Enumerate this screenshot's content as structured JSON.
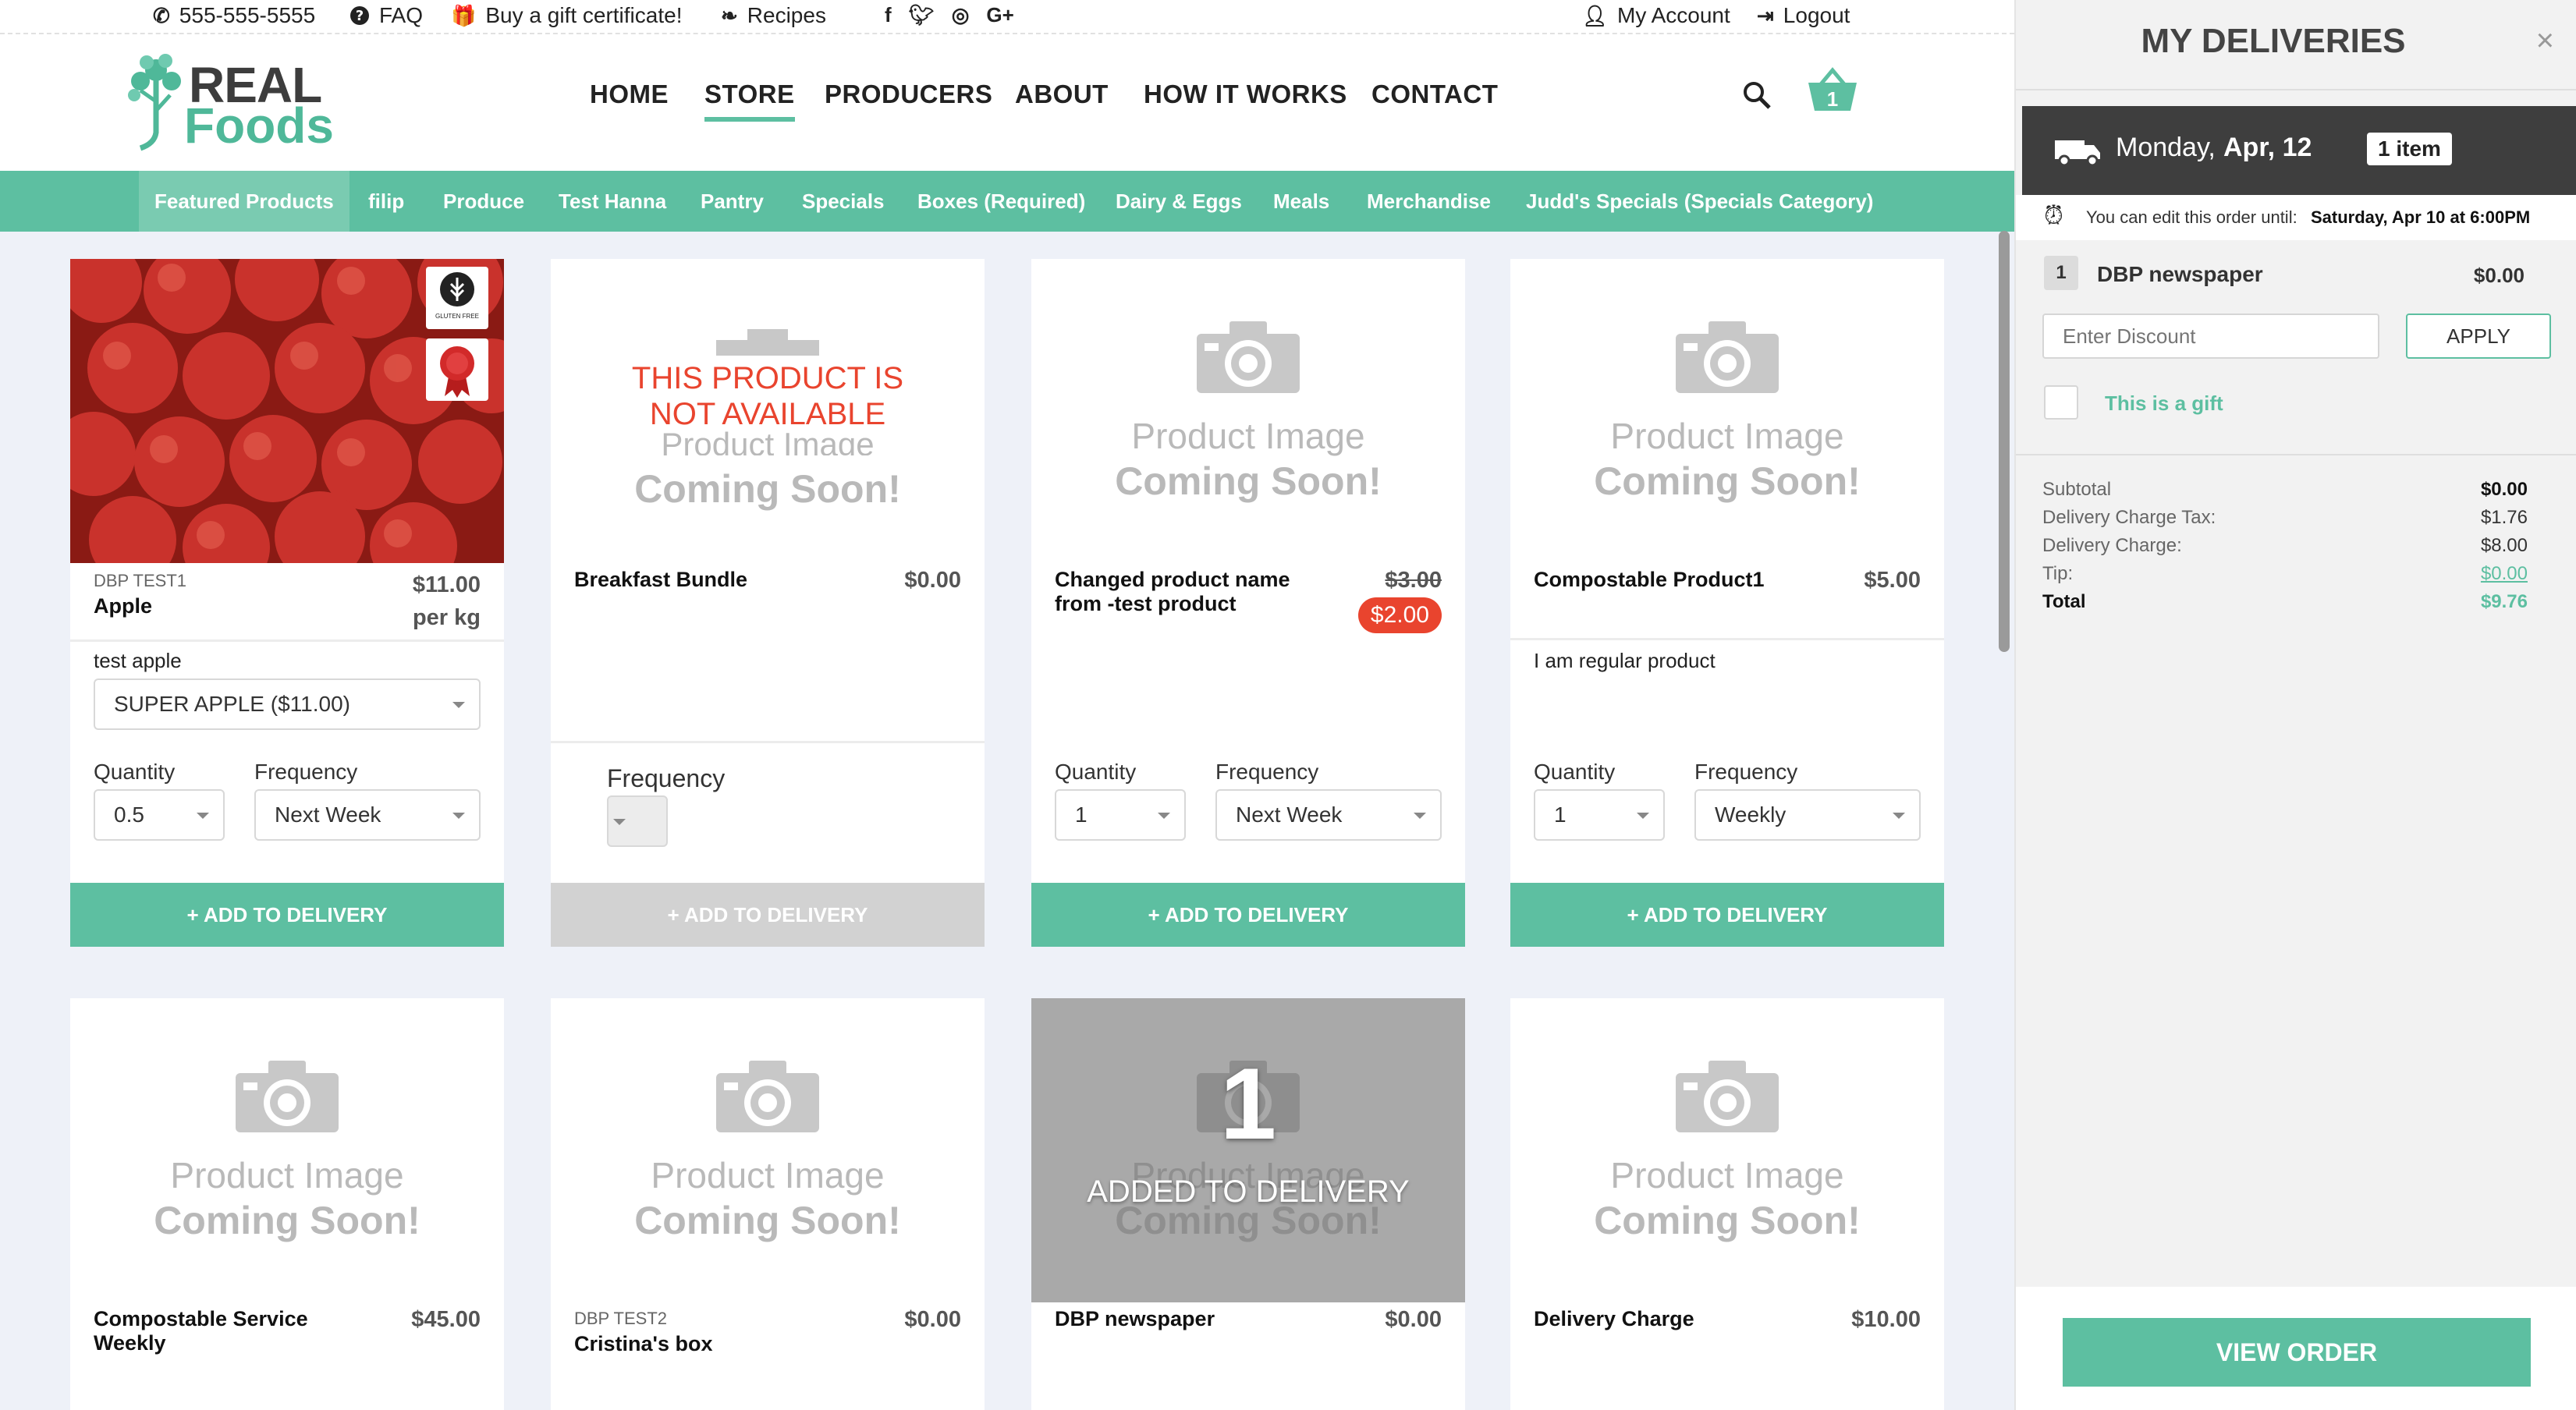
{
  "topbar": {
    "phone": "555-555-5555",
    "faq": "FAQ",
    "gift": "Buy a gift certificate!",
    "recipes": "Recipes",
    "account": "My Account",
    "logout": "Logout"
  },
  "logo": {
    "line1": "REAL",
    "line2": "Foods"
  },
  "nav": [
    "HOME",
    "STORE",
    "PRODUCERS",
    "ABOUT",
    "HOW IT WORKS",
    "CONTACT"
  ],
  "basket_count": "1",
  "categories": [
    "Featured Products",
    "filip",
    "Produce",
    "Test Hanna",
    "Pantry",
    "Specials",
    "Boxes (Required)",
    "Dairy & Eggs",
    "Meals",
    "Merchandise",
    "Judd's Specials (Specials Category)"
  ],
  "placeholder": {
    "line1": "Product Image",
    "line2": "Coming Soon!"
  },
  "labels": {
    "quantity": "Quantity",
    "frequency": "Frequency",
    "add": "+ ADD TO DELIVERY"
  },
  "products": [
    {
      "sku": "DBP TEST1",
      "name": "Apple",
      "price": "$11.00",
      "unit": "per kg",
      "desc": "test apple",
      "variant": "SUPER APPLE ($11.00)",
      "qty": "0.5",
      "freq": "Next Week",
      "badges": [
        "GLUTEN FREE"
      ]
    },
    {
      "name": "Breakfast Bundle",
      "price": "$0.00",
      "unavailable": "THIS PRODUCT IS NOT AVAILABLE"
    },
    {
      "name": "Changed product name from -test product",
      "old_price": "$3.00",
      "price": "$2.00",
      "qty": "1",
      "freq": "Next Week"
    },
    {
      "name": "Compostable Product1",
      "price": "$5.00",
      "desc": "I am regular product",
      "qty": "1",
      "freq": "Weekly"
    },
    {
      "name": "Compostable Service Weekly",
      "price": "$45.00"
    },
    {
      "sku": "DBP TEST2",
      "name": "Cristina's box",
      "price": "$0.00"
    },
    {
      "name": "DBP newspaper",
      "price": "$0.00",
      "added_count": "1",
      "added_text": "ADDED TO DELIVERY"
    },
    {
      "name": "Delivery Charge",
      "price": "$10.00"
    }
  ],
  "sidebar": {
    "title": "MY DELIVERIES",
    "day": "Monday,",
    "date": "Apr, 12",
    "items_badge": "1 item",
    "edit_note": "You can edit this order until:",
    "edit_deadline": "Saturday, Apr 10 at 6:00PM",
    "line_qty": "1",
    "line_name": "DBP newspaper",
    "line_price": "$0.00",
    "discount_placeholder": "Enter Discount",
    "apply": "APPLY",
    "gift_label": "This is a gift",
    "totals": [
      {
        "label": "Subtotal",
        "value": "$0.00"
      },
      {
        "label": "Delivery Charge Tax:",
        "value": "$1.76"
      },
      {
        "label": "Delivery Charge:",
        "value": "$8.00"
      },
      {
        "label": "Tip:",
        "value": "$0.00"
      },
      {
        "label": "Total",
        "value": "$9.76"
      }
    ],
    "view_order": "VIEW ORDER"
  },
  "colors": {
    "accent": "#5dbfa1",
    "sale_red": "#e9442e",
    "dark": "#3e3e3e"
  }
}
